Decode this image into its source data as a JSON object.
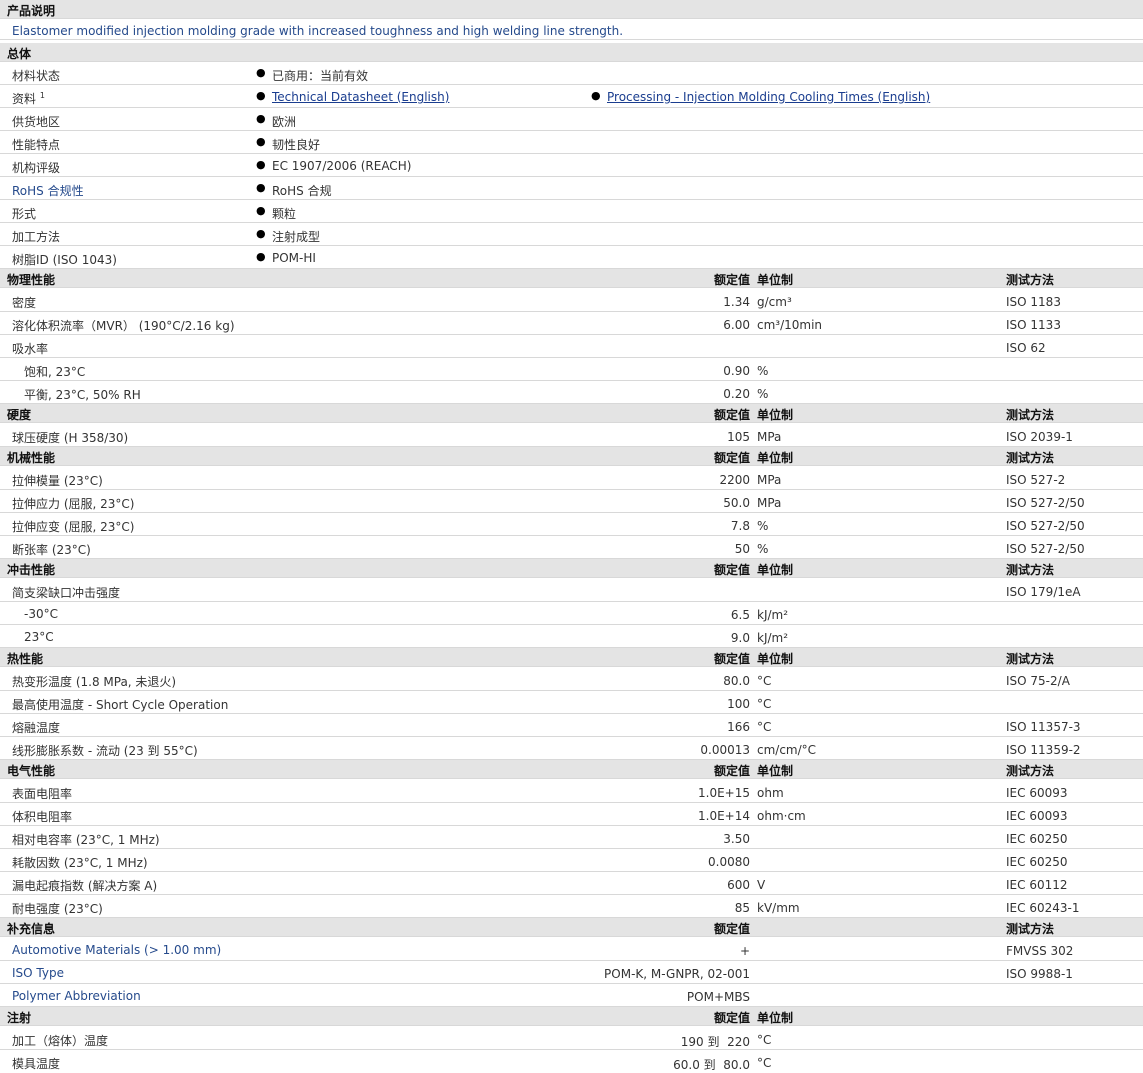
{
  "product_description": {
    "header": "产品说明",
    "text": "Elastomer modified injection molding grade with increased toughness and high welding line strength."
  },
  "general": {
    "header": "总体",
    "rows": [
      {
        "label": "材料状态",
        "value": "已商用：当前有效"
      },
      {
        "label": "资料",
        "sup": "1",
        "value": "Technical Datasheet (English)",
        "value2": "Processing - Injection Molding Cooling Times (English)"
      },
      {
        "label": "供货地区",
        "value": "欧洲"
      },
      {
        "label": "性能特点",
        "value": "韧性良好"
      },
      {
        "label": "机构评级",
        "value": "EC 1907/2006 (REACH)"
      },
      {
        "label": "RoHS 合规性",
        "value": "RoHS 合规"
      },
      {
        "label": "形式",
        "value": "颗粒"
      },
      {
        "label": "加工方法",
        "value": "注射成型"
      },
      {
        "label": "树脂ID (ISO 1043)",
        "value": "POM-HI"
      }
    ]
  },
  "columns": {
    "value": "额定值",
    "unit": "单位制",
    "method": "测试方法"
  },
  "physical": {
    "header": "物理性能",
    "rows": [
      {
        "label": "密度",
        "value": "1.34",
        "unit": "g/cm³",
        "method": "ISO 1183"
      },
      {
        "label": "溶化体积流率（MVR） (190°C/2.16 kg)",
        "value": "6.00",
        "unit": "cm³/10min",
        "method": "ISO 1133"
      },
      {
        "label": "吸水率",
        "value": "",
        "unit": "",
        "method": "ISO 62"
      },
      {
        "label": "饱和, 23°C",
        "sub": true,
        "value": "0.90",
        "unit": "%",
        "method": ""
      },
      {
        "label": "平衡, 23°C, 50% RH",
        "sub": true,
        "value": "0.20",
        "unit": "%",
        "method": ""
      }
    ]
  },
  "hardness": {
    "header": "硬度",
    "rows": [
      {
        "label": "球压硬度 (H 358/30)",
        "value": "105",
        "unit": "MPa",
        "method": "ISO 2039-1"
      }
    ]
  },
  "mechanical": {
    "header": "机械性能",
    "rows": [
      {
        "label": "拉伸模量 (23°C)",
        "value": "2200",
        "unit": "MPa",
        "method": "ISO 527-2"
      },
      {
        "label": "拉伸应力 (屈服, 23°C)",
        "value": "50.0",
        "unit": "MPa",
        "method": "ISO 527-2/50"
      },
      {
        "label": "拉伸应变 (屈服, 23°C)",
        "value": "7.8",
        "unit": "%",
        "method": "ISO 527-2/50"
      },
      {
        "label": "断张率 (23°C)",
        "value": "50",
        "unit": "%",
        "method": "ISO 527-2/50"
      }
    ]
  },
  "impact": {
    "header": "冲击性能",
    "rows": [
      {
        "label": "简支梁缺口冲击强度",
        "value": "",
        "unit": "",
        "method": "ISO 179/1eA"
      },
      {
        "label": "-30°C",
        "sub": true,
        "value": "6.5",
        "unit": "kJ/m²",
        "method": ""
      },
      {
        "label": "23°C",
        "sub": true,
        "value": "9.0",
        "unit": "kJ/m²",
        "method": ""
      }
    ]
  },
  "thermal": {
    "header": "热性能",
    "rows": [
      {
        "label": "热变形温度 (1.8 MPa, 未退火)",
        "value": "80.0",
        "unit": "°C",
        "method": "ISO 75-2/A"
      },
      {
        "label": "最高使用温度 - Short Cycle Operation",
        "value": "100",
        "unit": "°C",
        "method": ""
      },
      {
        "label": "熔融温度",
        "value": "166",
        "unit": "°C",
        "method": "ISO 11357-3"
      },
      {
        "label": "线形膨胀系数 - 流动 (23 到 55°C)",
        "value": "0.00013",
        "unit": "cm/cm/°C",
        "method": "ISO 11359-2"
      }
    ]
  },
  "electrical": {
    "header": "电气性能",
    "rows": [
      {
        "label": "表面电阻率",
        "value": "1.0E+15",
        "unit": "ohm",
        "method": "IEC 60093"
      },
      {
        "label": "体积电阻率",
        "value": "1.0E+14",
        "unit": "ohm·cm",
        "method": "IEC 60093"
      },
      {
        "label": "相对电容率 (23°C, 1 MHz)",
        "value": "3.50",
        "unit": "",
        "method": "IEC 60250"
      },
      {
        "label": "耗散因数 (23°C, 1 MHz)",
        "value": "0.0080",
        "unit": "",
        "method": "IEC 60250"
      },
      {
        "label": "漏电起痕指数 (解决方案 A)",
        "value": "600",
        "unit": "V",
        "method": "IEC 60112"
      },
      {
        "label": "耐电强度 (23°C)",
        "value": "85",
        "unit": "kV/mm",
        "method": "IEC 60243-1"
      }
    ]
  },
  "supplemental": {
    "header": "补充信息",
    "rows": [
      {
        "label": "Automotive Materials (> 1.00 mm)",
        "value": "+",
        "unit": "",
        "method": "FMVSS 302"
      },
      {
        "label": "ISO Type",
        "value": "POM-K, M-GNPR, 02-001",
        "unit": "",
        "method": "ISO 9988-1"
      },
      {
        "label": "Polymer Abbreviation",
        "value": "POM+MBS",
        "unit": "",
        "method": ""
      }
    ]
  },
  "injection": {
    "header": "注射",
    "rows": [
      {
        "label": "加工（熔体）温度",
        "value": "190 到  220",
        "unit": "°C",
        "method": ""
      },
      {
        "label": "模具温度",
        "value": "60.0 到  80.0",
        "unit": "°C",
        "method": ""
      }
    ]
  }
}
